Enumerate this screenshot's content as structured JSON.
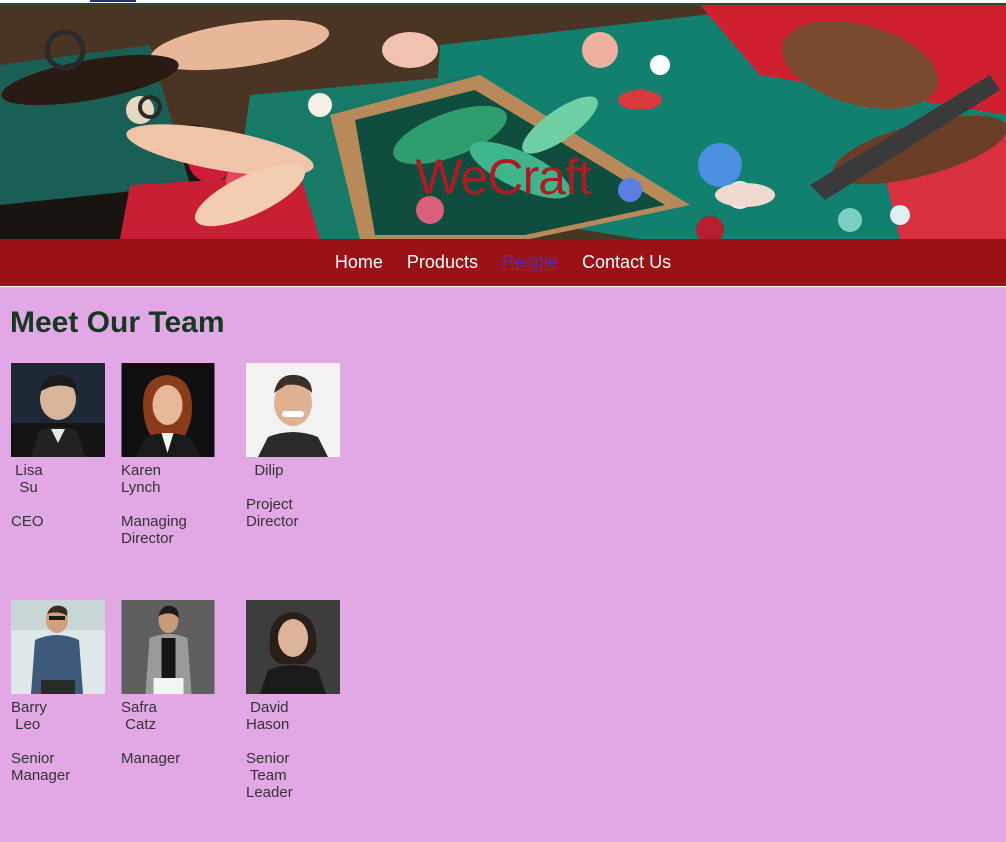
{
  "site": {
    "title": "WeCraft"
  },
  "nav": {
    "items": [
      {
        "label": "Home"
      },
      {
        "label": "Products"
      },
      {
        "label": "People"
      },
      {
        "label": "Contact Us"
      }
    ]
  },
  "main": {
    "heading": "Meet Our Team",
    "members": [
      {
        "name": " Lisa\n  Su",
        "role": "CEO"
      },
      {
        "name": "Karen\nLynch",
        "role": "Managing\nDirector"
      },
      {
        "name": "  Dilip",
        "role": "Project\nDirector"
      },
      {
        "name": "Barry\n Leo",
        "role": "Senior\nManager"
      },
      {
        "name": "Safra\n Catz",
        "role": "Manager"
      },
      {
        "name": " David\nHason",
        "role": "Senior\n Team\nLeader"
      }
    ]
  },
  "colors": {
    "nav_bg": "#9a1116",
    "page_bg": "#e2a8e6",
    "title_red": "#b01a22",
    "heading_green": "#14391f"
  }
}
